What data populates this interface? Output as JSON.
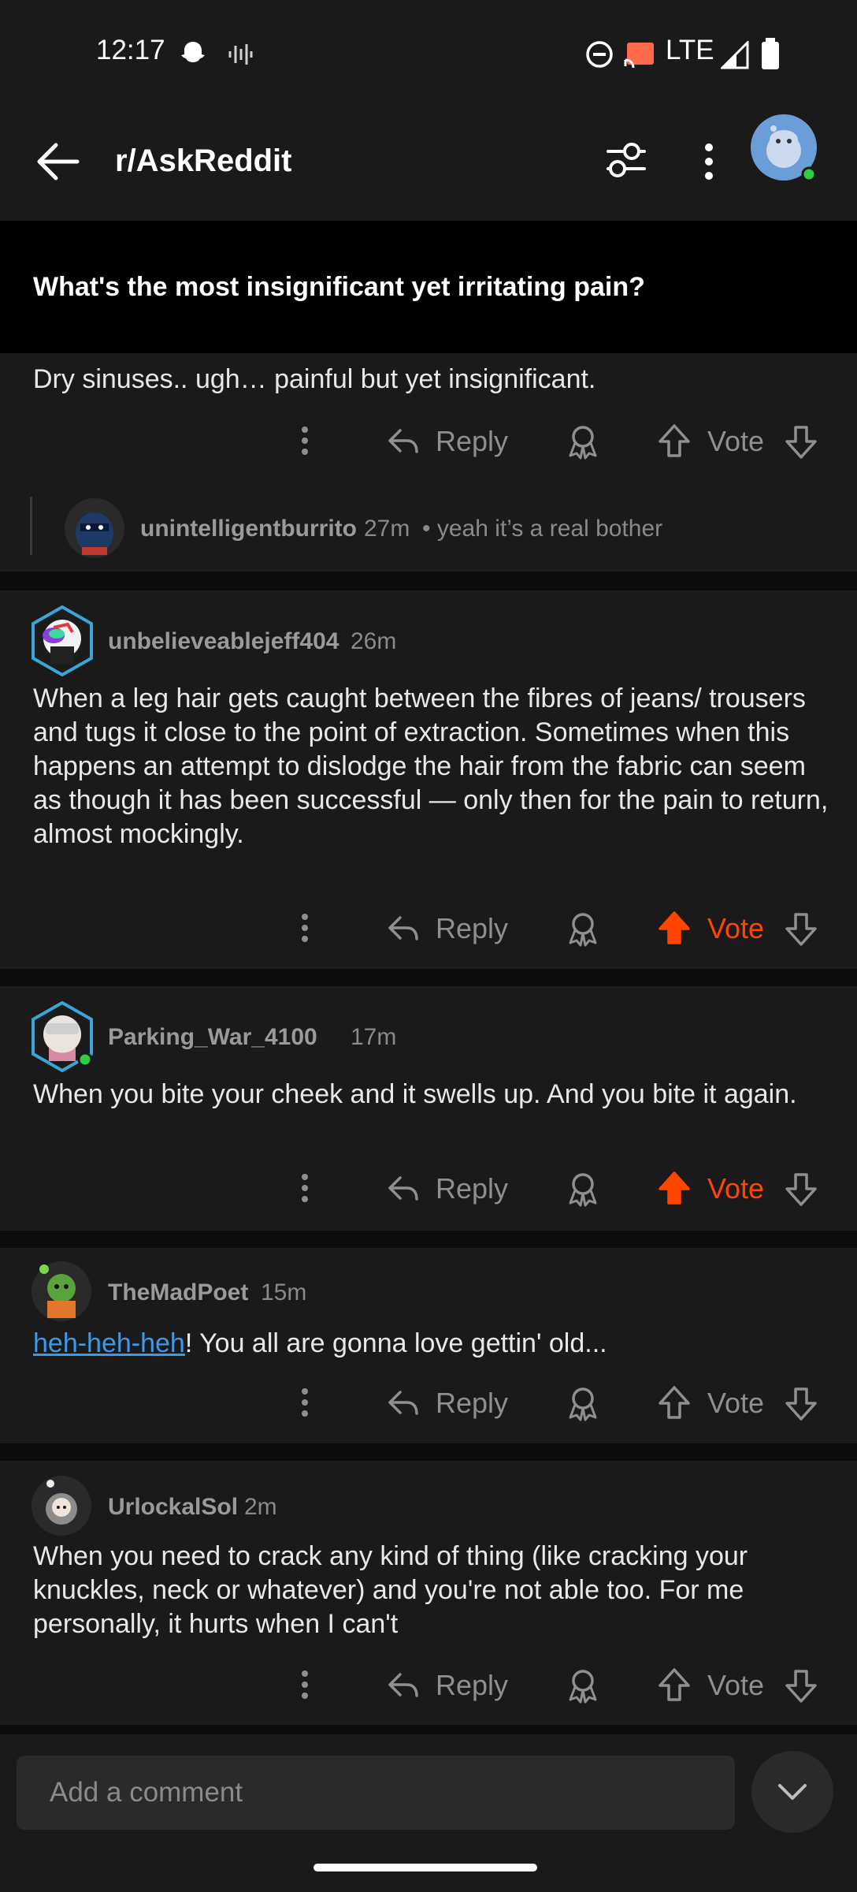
{
  "status_bar": {
    "time": "12:17",
    "network": "LTE"
  },
  "header": {
    "subreddit": "r/AskReddit"
  },
  "post": {
    "title": "What's the most insignificant yet irritating pain?"
  },
  "partial_comment": {
    "text": "Dry sinuses.. ugh… painful but yet insignificant."
  },
  "reply": {
    "user": "unintelligentburrito",
    "time": "27m",
    "preview": "• yeah it’s a real bother"
  },
  "comments": [
    {
      "user": "unbelieveablejeff404",
      "time": "26m",
      "text": "When a leg hair gets caught between the fibres of jeans/ trousers and tugs it close to the point of extraction. Sometimes when this happens an attempt to dislodge the hair from the fabric can seem as though it has been successful — only then for the pain to return, almost mockingly.",
      "upvoted": true
    },
    {
      "user": "Parking_War_4100",
      "time": "17m",
      "text": "When you bite your cheek and it swells up. And you bite it again.",
      "upvoted": true
    },
    {
      "user": "TheMadPoet",
      "time": "15m",
      "link": "heh-heh-heh",
      "text": "! You all are gonna love gettin' old...",
      "upvoted": false
    },
    {
      "user": "UrlockalSol",
      "time": "2m",
      "text": "When you need to crack any kind of thing (like cracking your knuckles, neck or whatever) and you're not able too. For me personally, it hurts when I can't",
      "upvoted": false
    }
  ],
  "labels": {
    "reply": "Reply",
    "vote": "Vote"
  },
  "comment_input": {
    "placeholder": "Add a comment"
  },
  "colors": {
    "upvote": "#ff4500",
    "background": "#1a1a1b",
    "link": "#3d9ae8"
  },
  "icons": [
    "back-arrow-icon",
    "filter-icon",
    "more-icon",
    "avatar",
    "more-options-icon",
    "reply-icon",
    "award-icon",
    "upvote-icon",
    "downvote-icon",
    "chevron-down-icon"
  ]
}
